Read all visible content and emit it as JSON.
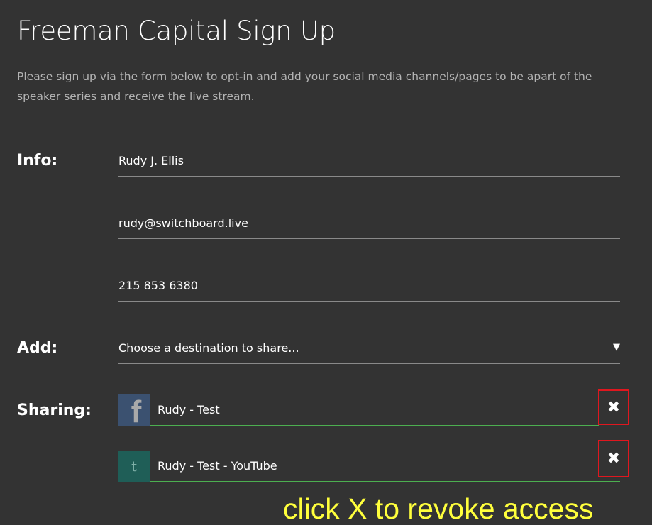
{
  "header": {
    "title": "Freeman Capital Sign Up",
    "subtitle": "Please sign up via the form below to opt-in and add your social media channels/pages to be apart of the speaker series and receive the live stream."
  },
  "info": {
    "label": "Info:",
    "name_value": "Rudy J. Ellis",
    "email_value": "rudy@switchboard.live",
    "phone_value": "215 853 6380"
  },
  "add": {
    "label": "Add:",
    "selected": "Choose a destination to share...",
    "arrow": "▼"
  },
  "sharing": {
    "label": "Sharing:",
    "items": [
      {
        "icon": "facebook-icon",
        "glyph": "f",
        "name": "Rudy - Test",
        "remove": "✖"
      },
      {
        "icon": "twitch-icon",
        "glyph": "t",
        "name": "Rudy - Test - YouTube",
        "remove": "✖"
      }
    ]
  },
  "annotation": "click X to revoke access",
  "colors": {
    "background": "#333333",
    "accent_green": "#4caf50",
    "highlight_red": "#e0171f",
    "annotation_yellow": "#ffff3c"
  }
}
